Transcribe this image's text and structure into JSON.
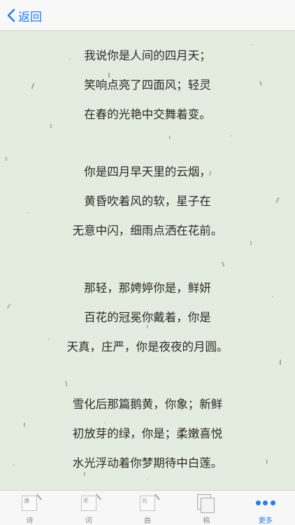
{
  "nav": {
    "back_label": "返回"
  },
  "poem": {
    "stanzas": [
      [
        "我说你是人间的四月天；",
        "笑响点亮了四面风；轻灵",
        "在春的光艳中交舞着变。"
      ],
      [
        "你是四月早天里的云烟，",
        "黄昏吹着风的软，星子在",
        "无意中闪，细雨点洒在花前。"
      ],
      [
        "那轻，那娉婷你是，鲜妍",
        "百花的冠冕你戴着，你是",
        "天真，庄严，你是夜夜的月圆。"
      ],
      [
        "雪化后那篇鹅黄，你象；新鲜",
        "初放芽的绿，你是；柔嫩喜悦",
        "水光浮动着你梦期待中白莲。"
      ]
    ]
  },
  "tabs": [
    {
      "label": "诗",
      "icon_char": "唐",
      "icon": "tang-page-icon",
      "active": false
    },
    {
      "label": "词",
      "icon_char": "宋",
      "icon": "song-page-icon",
      "active": false
    },
    {
      "label": "曲",
      "icon_char": "元",
      "icon": "yuan-page-icon",
      "active": false
    },
    {
      "label": "稿",
      "icon_char": "",
      "icon": "draft-pages-icon",
      "active": false
    },
    {
      "label": "更多",
      "icon_char": "",
      "icon": "more-dots-icon",
      "active": true
    }
  ],
  "colors": {
    "accent": "#1f7ef5",
    "paper": "#e4ecdf",
    "text": "#2b2b2b"
  }
}
